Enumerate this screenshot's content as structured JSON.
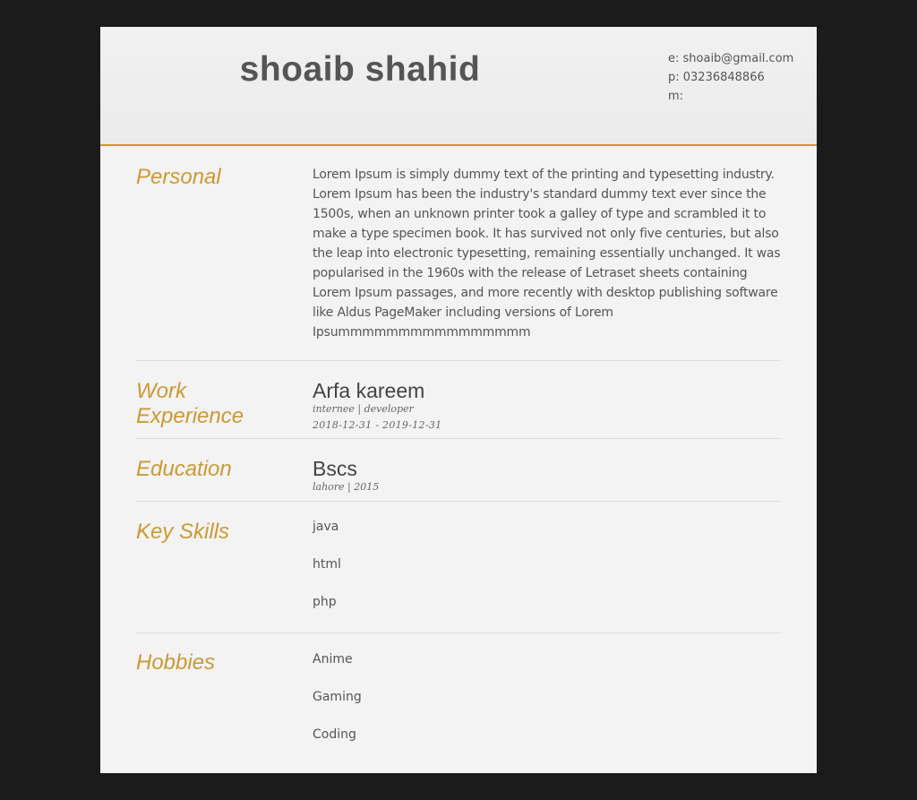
{
  "header": {
    "name": "shoaib shahid",
    "email_line": "e: shoaib@gmail.com",
    "phone_line": "p: 03236848866",
    "mobile_line": "m:"
  },
  "sections": {
    "personal": {
      "title": "Personal",
      "text": "Lorem Ipsum is simply dummy text of the printing and typesetting industry. Lorem Ipsum has been the industry's standard dummy text ever since the 1500s, when an unknown printer took a galley of type and scrambled it to make a type specimen book. It has survived not only five centuries, but also the leap into electronic typesetting, remaining essentially unchanged. It was popularised in the 1960s with the release of Letraset sheets containing Lorem Ipsum passages, and more recently with desktop publishing software like Aldus PageMaker including versions of Lorem Ipsummmmmmmmmmmmmmmm"
    },
    "work": {
      "title": "Work Experience",
      "company": "Arfa kareem",
      "role": "internee | developer",
      "dates": "2018-12-31 - 2019-12-31"
    },
    "education": {
      "title": "Education",
      "degree": "Bscs",
      "details": "lahore | 2015"
    },
    "skills": {
      "title": "Key Skills",
      "items": [
        "java",
        "html",
        "php"
      ]
    },
    "hobbies": {
      "title": "Hobbies",
      "items": [
        "Anime",
        "Gaming",
        "Coding"
      ]
    }
  },
  "colors": {
    "accent": "#cc9933",
    "background": "#1b1b1b",
    "page": "#f3f3f3",
    "text": "#555555"
  }
}
